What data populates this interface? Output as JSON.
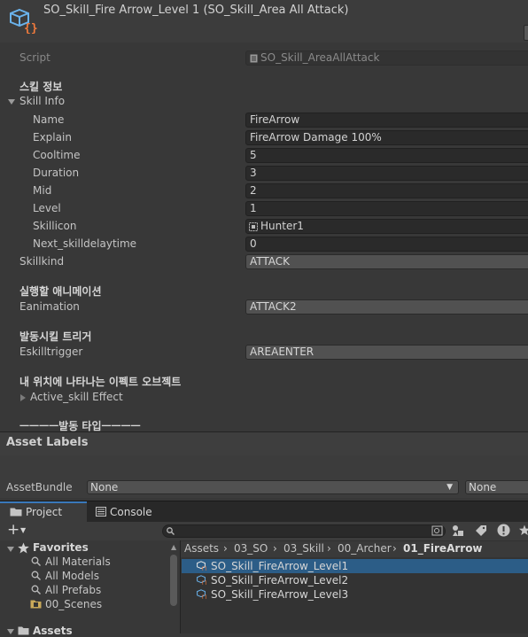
{
  "header": {
    "title": "SO_Skill_Fire Arrow_Level 1 (SO_Skill_Area All Attack)"
  },
  "script": {
    "label": "Script",
    "value": "SO_Skill_AreaAllAttack"
  },
  "skill_info_header": "스킬 정보",
  "skill_info": {
    "label": "Skill Info",
    "fields": [
      {
        "label": "Name",
        "value": "FireArrow"
      },
      {
        "label": "Explain",
        "value": "FireArrow Damage 100%"
      },
      {
        "label": "Cooltime",
        "value": "5"
      },
      {
        "label": "Duration",
        "value": "3"
      },
      {
        "label": "Mid",
        "value": "2"
      },
      {
        "label": "Level",
        "value": "1"
      },
      {
        "label": "Skillicon",
        "value": "Hunter1"
      },
      {
        "label": "Next_skilldelaytime",
        "value": "0"
      }
    ]
  },
  "skillkind": {
    "label": "Skillkind",
    "value": "ATTACK"
  },
  "anim_header": "실행할 애니메이션",
  "eanimation": {
    "label": "Eanimation",
    "value": "ATTACK2"
  },
  "trigger_header": "발동시킬 트리거",
  "eskilltrigger": {
    "label": "Eskilltrigger",
    "value": "AREAENTER"
  },
  "effect_header": "내 위치에 나타나는 이펙트 오브젝트",
  "active_effect": {
    "label": "Active_skill Effect"
  },
  "type_header": "ㅡㅡㅡㅡ발동 타입ㅡㅡㅡㅡ",
  "asset_labels": {
    "title": "Asset Labels",
    "bundle_label": "AssetBundle",
    "bundle_value": "None",
    "variant_value": "None"
  },
  "tabs": {
    "project": "Project",
    "console": "Console"
  },
  "breadcrumb": [
    "Assets",
    "03_SO",
    "03_Skill",
    "00_Archer",
    "01_FireArrow"
  ],
  "favorites": {
    "label": "Favorites",
    "items": [
      "All Materials",
      "All Models",
      "All Prefabs",
      "00_Scenes"
    ]
  },
  "assets_root": "Assets",
  "files": [
    "SO_Skill_FireArrow_Level1",
    "SO_Skill_FireArrow_Level2",
    "SO_Skill_FireArrow_Level3"
  ],
  "colors": {
    "accent": "#3a79bb",
    "selection": "#2c5d87",
    "background": "#383838"
  }
}
